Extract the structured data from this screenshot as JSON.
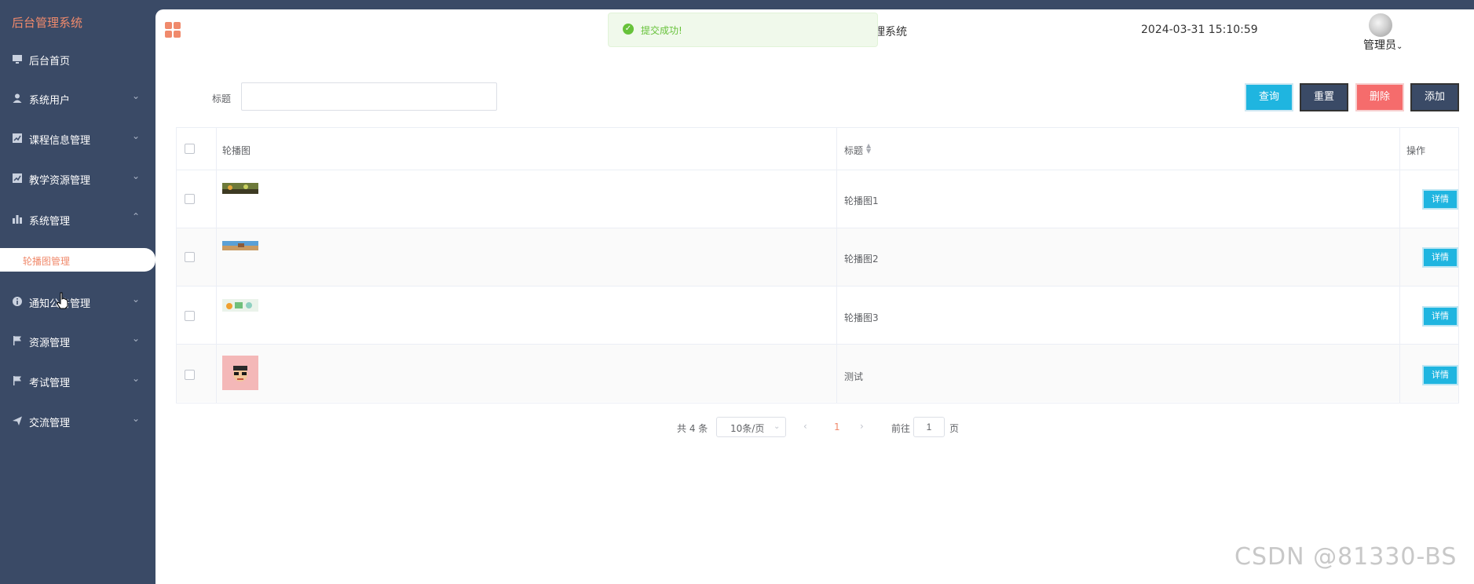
{
  "brand": "后台管理系统",
  "sidebar": {
    "items": [
      {
        "label": "后台首页",
        "icon": "monitor-icon",
        "chevron": ""
      },
      {
        "label": "系统用户",
        "icon": "user-icon",
        "chevron": "⌄"
      },
      {
        "label": "课程信息管理",
        "icon": "chart-icon",
        "chevron": "⌄"
      },
      {
        "label": "教学资源管理",
        "icon": "chart-icon",
        "chevron": "⌄"
      },
      {
        "label": "系统管理",
        "icon": "bar-chart-icon",
        "chevron": "⌃"
      },
      {
        "label": "通知公告管理",
        "icon": "info-icon",
        "chevron": "⌄"
      },
      {
        "label": "资源管理",
        "icon": "flag-icon",
        "chevron": "⌄"
      },
      {
        "label": "考试管理",
        "icon": "flag-icon",
        "chevron": "⌄"
      },
      {
        "label": "交流管理",
        "icon": "send-icon",
        "chevron": "⌄"
      }
    ],
    "active_sub": "轮播图管理"
  },
  "header": {
    "title_partial": "理系统",
    "datetime": "2024-03-31 15:10:59",
    "user": "管理员"
  },
  "toast": {
    "message": "提交成功!",
    "status": "success",
    "color": "#67c23a"
  },
  "search": {
    "label": "标题",
    "value": "",
    "placeholder": ""
  },
  "buttons": {
    "query": "查询",
    "reset": "重置",
    "delete": "删除",
    "add": "添加"
  },
  "table": {
    "headers": [
      "轮播图",
      "标题",
      "操作"
    ],
    "rows": [
      {
        "title": "轮播图1",
        "action": "详情"
      },
      {
        "title": "轮播图2",
        "action": "详情"
      },
      {
        "title": "轮播图3",
        "action": "详情"
      },
      {
        "title": "测试",
        "action": "详情"
      }
    ]
  },
  "pagination": {
    "total": "共 4 条",
    "page_size": "10条/页",
    "current": "1",
    "goto": "前往",
    "goto_value": "1",
    "page_unit": "页"
  },
  "watermark": "CSDN @81330-BS",
  "colors": {
    "accent": "#f08a6c",
    "sidebar": "#3a4a66",
    "primary": "#1fb5e0",
    "danger": "#f56c6c"
  }
}
